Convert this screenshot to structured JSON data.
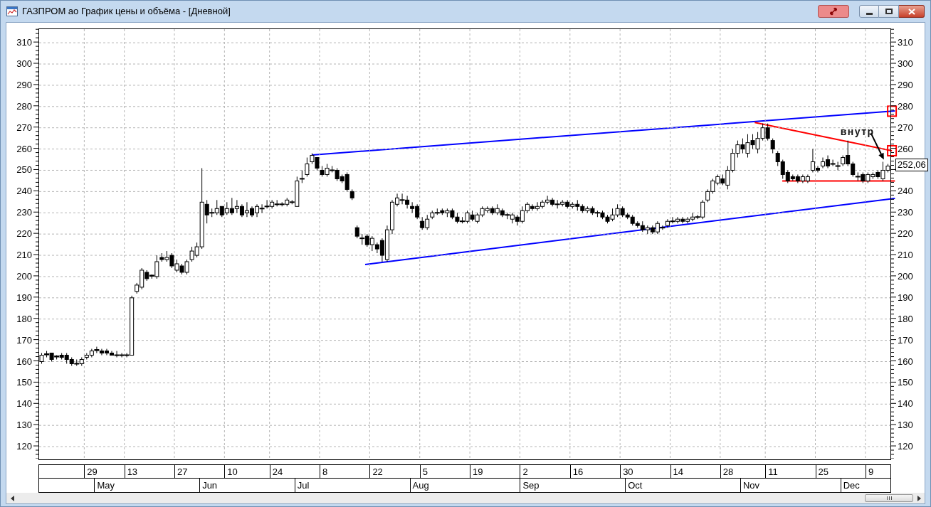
{
  "window": {
    "title": "ГАЗПРОМ ао График цены и объёма - [Дневной]"
  },
  "chart": {
    "chart_data": {
      "type": "candlestick",
      "ylim": [
        114,
        316.4
      ],
      "grid": true,
      "yticks": [
        310,
        300,
        290,
        280,
        270,
        260,
        250,
        240,
        230,
        220,
        210,
        200,
        190,
        180,
        170,
        160,
        150,
        140,
        130,
        120
      ],
      "categories": [
        null,
        null,
        null,
        null,
        null,
        null,
        null,
        null,
        null,
        null,
        "29",
        null,
        null,
        null,
        null,
        null,
        null,
        null,
        "13",
        null,
        null,
        null,
        null,
        null,
        null,
        null,
        null,
        null,
        "27",
        null,
        null,
        null,
        null,
        null,
        null,
        null,
        null,
        null,
        "10",
        null,
        null,
        null,
        null,
        null,
        null,
        null,
        null,
        "24",
        null,
        null,
        null,
        null,
        null,
        null,
        null,
        null,
        null,
        "8",
        null,
        null,
        null,
        null,
        null,
        null,
        null,
        null,
        null,
        "22",
        null,
        null,
        null,
        null,
        null,
        null,
        null,
        null,
        null,
        "5",
        null,
        null,
        null,
        null,
        null,
        null,
        null,
        null,
        null,
        "19",
        null,
        null,
        null,
        null,
        null,
        null,
        null,
        null,
        null,
        "2",
        null,
        null,
        null,
        null,
        null,
        null,
        null,
        null,
        null,
        "16",
        null,
        null,
        null,
        null,
        null,
        null,
        null,
        null,
        null,
        "30",
        null,
        null,
        null,
        null,
        null,
        null,
        null,
        null,
        null,
        "14",
        null,
        null,
        null,
        null,
        null,
        null,
        null,
        null,
        null,
        "28",
        null,
        null,
        null,
        null,
        null,
        null,
        null,
        null,
        "11",
        null,
        null,
        null,
        null,
        null,
        null,
        null,
        null,
        null,
        "25",
        null,
        null,
        null,
        null,
        null,
        null,
        null,
        null,
        null,
        "9",
        null,
        null,
        null
      ],
      "ohlc": [
        [
          160,
          164,
          159,
          163
        ],
        [
          163,
          165,
          162,
          163.5
        ],
        [
          164,
          164,
          160,
          161
        ],
        [
          162,
          163,
          161,
          162.5
        ],
        [
          163,
          164,
          161,
          162
        ],
        [
          163,
          164,
          159,
          161
        ],
        [
          161,
          162,
          158,
          159
        ],
        [
          159,
          161,
          158,
          159
        ],
        [
          159,
          162,
          158,
          161
        ],
        [
          162,
          164,
          161,
          163
        ],
        [
          163,
          166,
          162,
          165
        ],
        [
          165,
          167,
          164,
          165.5
        ],
        [
          165,
          166,
          163,
          164
        ],
        [
          165,
          166,
          163,
          164
        ],
        [
          164,
          165,
          163,
          163
        ],
        [
          163,
          165,
          162,
          163
        ],
        [
          163,
          164,
          162,
          163
        ],
        [
          163,
          164,
          162,
          163
        ],
        [
          163,
          191,
          163,
          190
        ],
        [
          193,
          197,
          192,
          196
        ],
        [
          195,
          204,
          194,
          203
        ],
        [
          202,
          203,
          198,
          199
        ],
        [
          200,
          201,
          199,
          200.5
        ],
        [
          200,
          210,
          199,
          207
        ],
        [
          209,
          211,
          207,
          208
        ],
        [
          208,
          212,
          207,
          209
        ],
        [
          210,
          211,
          204,
          205
        ],
        [
          203,
          208,
          202,
          206
        ],
        [
          205,
          206,
          201,
          202
        ],
        [
          202,
          208,
          201,
          207
        ],
        [
          208,
          214,
          207,
          212
        ],
        [
          210,
          216,
          209,
          214
        ],
        [
          214,
          251,
          213,
          235
        ],
        [
          234,
          236,
          225,
          229
        ],
        [
          230,
          232,
          228,
          230
        ],
        [
          230,
          236,
          229,
          232
        ],
        [
          233,
          233,
          228,
          229
        ],
        [
          230,
          235,
          229,
          232
        ],
        [
          232,
          237,
          229,
          230
        ],
        [
          232,
          236,
          230,
          233
        ],
        [
          233,
          234,
          228,
          229
        ],
        [
          230,
          235,
          228,
          231
        ],
        [
          232,
          233,
          228,
          229
        ],
        [
          230,
          234,
          228,
          233
        ],
        [
          232,
          234,
          230,
          232
        ],
        [
          233,
          236,
          232,
          233
        ],
        [
          233,
          236,
          232,
          235
        ],
        [
          234,
          236,
          233,
          234
        ],
        [
          234,
          235,
          233,
          234
        ],
        [
          234,
          237,
          233,
          236
        ],
        [
          235,
          236,
          234,
          235
        ],
        [
          233,
          247,
          233,
          245
        ],
        [
          246,
          250,
          244,
          246
        ],
        [
          248,
          256,
          247,
          253
        ],
        [
          254,
          258,
          253,
          257
        ],
        [
          256,
          256,
          250,
          251
        ],
        [
          250,
          252,
          247,
          248
        ],
        [
          248,
          253,
          247,
          251
        ],
        [
          250,
          252,
          249,
          250
        ],
        [
          250,
          251,
          245,
          246
        ],
        [
          247,
          248,
          244,
          245
        ],
        [
          248,
          249,
          240,
          241
        ],
        [
          240,
          241,
          236,
          237
        ],
        [
          223,
          224,
          218,
          219
        ],
        [
          218,
          220,
          215,
          218
        ],
        [
          219,
          220,
          214,
          215
        ],
        [
          215,
          219,
          212,
          218
        ],
        [
          215,
          216,
          211,
          213
        ],
        [
          217,
          218,
          207,
          210
        ],
        [
          208,
          224,
          207,
          222
        ],
        [
          222,
          236,
          220,
          235
        ],
        [
          234,
          239,
          233,
          237
        ],
        [
          236,
          239,
          234,
          236
        ],
        [
          236,
          238,
          232,
          234
        ],
        [
          233,
          235,
          230,
          232
        ],
        [
          233,
          234,
          227,
          228
        ],
        [
          226,
          228,
          222,
          223
        ],
        [
          223,
          229,
          222,
          227
        ],
        [
          228,
          231,
          227,
          230
        ],
        [
          230,
          232,
          229,
          230
        ],
        [
          231,
          232,
          229,
          230
        ],
        [
          230,
          232,
          228,
          231
        ],
        [
          231,
          232,
          227,
          228
        ],
        [
          228,
          230,
          225,
          226
        ],
        [
          226,
          228,
          225,
          226
        ],
        [
          226,
          231,
          225,
          230
        ],
        [
          229,
          231,
          226,
          227
        ],
        [
          226,
          230,
          225,
          229
        ],
        [
          229,
          233,
          228,
          232
        ],
        [
          231,
          233,
          230,
          232
        ],
        [
          232,
          233,
          229,
          230
        ],
        [
          230,
          234,
          229,
          232
        ],
        [
          231,
          232,
          228,
          229
        ],
        [
          229,
          230,
          227,
          229
        ],
        [
          227,
          230,
          225,
          229
        ],
        [
          228,
          229,
          224,
          226
        ],
        [
          226,
          233,
          225,
          231
        ],
        [
          231,
          235,
          230,
          234
        ],
        [
          233,
          234,
          231,
          232
        ],
        [
          232,
          235,
          231,
          233
        ],
        [
          233,
          236,
          232,
          235
        ],
        [
          235,
          238,
          234,
          236
        ],
        [
          236,
          237,
          233,
          234
        ],
        [
          234,
          236,
          232,
          234
        ],
        [
          234,
          236,
          233,
          235
        ],
        [
          235,
          236,
          232,
          233
        ],
        [
          233,
          235,
          232,
          234
        ],
        [
          234,
          236,
          231,
          233
        ],
        [
          233,
          234,
          230,
          231
        ],
        [
          231,
          233,
          230,
          232
        ],
        [
          232,
          233,
          229,
          230
        ],
        [
          230,
          231,
          228,
          230
        ],
        [
          230,
          231,
          227,
          228
        ],
        [
          228,
          229,
          225,
          226
        ],
        [
          227,
          232,
          226,
          229
        ],
        [
          229,
          234,
          228,
          232
        ],
        [
          232,
          233,
          228,
          229
        ],
        [
          229,
          230,
          227,
          228
        ],
        [
          228,
          229,
          224,
          225
        ],
        [
          225,
          226,
          223,
          224
        ],
        [
          224,
          226,
          221,
          222
        ],
        [
          222,
          224,
          220,
          223
        ],
        [
          223,
          224,
          220,
          221
        ],
        [
          221,
          226,
          220,
          225
        ],
        [
          223,
          224,
          222,
          223
        ],
        [
          224,
          227,
          223,
          226
        ],
        [
          226,
          228,
          225,
          226
        ],
        [
          226,
          228,
          225,
          227
        ],
        [
          227,
          228,
          225,
          226
        ],
        [
          226,
          228,
          225,
          227
        ],
        [
          227,
          230,
          226,
          228
        ],
        [
          228,
          229,
          227,
          228
        ],
        [
          228,
          236,
          227,
          235
        ],
        [
          236,
          241,
          235,
          240
        ],
        [
          240,
          246,
          239,
          245
        ],
        [
          244,
          248,
          243,
          247
        ],
        [
          246,
          248,
          243,
          244
        ],
        [
          243,
          252,
          241,
          250
        ],
        [
          250,
          260,
          249,
          258
        ],
        [
          258,
          264,
          256,
          262
        ],
        [
          262,
          265,
          258,
          260
        ],
        [
          258,
          267,
          256,
          263
        ],
        [
          264,
          267,
          260,
          262
        ],
        [
          260,
          268,
          258,
          265
        ],
        [
          265,
          272,
          264,
          270
        ],
        [
          270,
          272,
          264,
          265
        ],
        [
          264,
          265,
          258,
          260
        ],
        [
          258,
          259,
          252,
          254
        ],
        [
          254,
          255,
          246,
          248
        ],
        [
          249,
          250,
          244,
          245
        ],
        [
          247,
          248,
          245,
          246
        ],
        [
          247,
          248,
          244,
          245
        ],
        [
          245,
          248,
          244,
          247
        ],
        [
          245,
          248,
          244,
          247
        ],
        [
          250,
          260,
          249,
          254
        ],
        [
          251,
          252,
          249,
          250
        ],
        [
          252,
          256,
          251,
          254
        ],
        [
          255,
          257,
          251,
          252
        ],
        [
          253,
          255,
          252,
          253
        ],
        [
          252,
          254,
          250,
          252
        ],
        [
          253,
          257,
          252,
          256
        ],
        [
          257,
          264,
          252,
          253
        ],
        [
          253,
          254,
          247,
          248
        ],
        [
          247,
          249,
          245,
          247
        ],
        [
          248,
          249,
          244,
          245
        ],
        [
          245,
          249,
          244,
          248
        ],
        [
          247,
          249,
          246,
          248
        ],
        [
          249,
          250,
          246,
          247
        ],
        [
          246,
          254,
          245,
          250
        ],
        [
          250,
          253,
          249,
          252
        ]
      ]
    },
    "right_axis_labels": [
      "310",
      "300",
      "290",
      "280",
      "270",
      "260",
      "240",
      "230",
      "220",
      "210",
      "200",
      "190",
      "180",
      "170",
      "160",
      "150",
      "140",
      "130",
      "120"
    ],
    "last_price": "252,06",
    "overlays": [
      {
        "kind": "line",
        "color": "#0000ff"
      },
      {
        "kind": "line",
        "color": "#0000ff"
      },
      {
        "kind": "line",
        "color": "#ff0000"
      },
      {
        "kind": "line",
        "color": "#ff0000"
      },
      {
        "kind": "marker",
        "color": "#ff0000"
      },
      {
        "kind": "marker",
        "color": "#ff0000"
      },
      {
        "kind": "arrow"
      },
      {
        "kind": "text",
        "text": "внутр"
      }
    ],
    "month_labels": [
      "May",
      "Jun",
      "Jul",
      "Aug",
      "Sep",
      "Oct",
      "Nov",
      "Dec"
    ]
  }
}
